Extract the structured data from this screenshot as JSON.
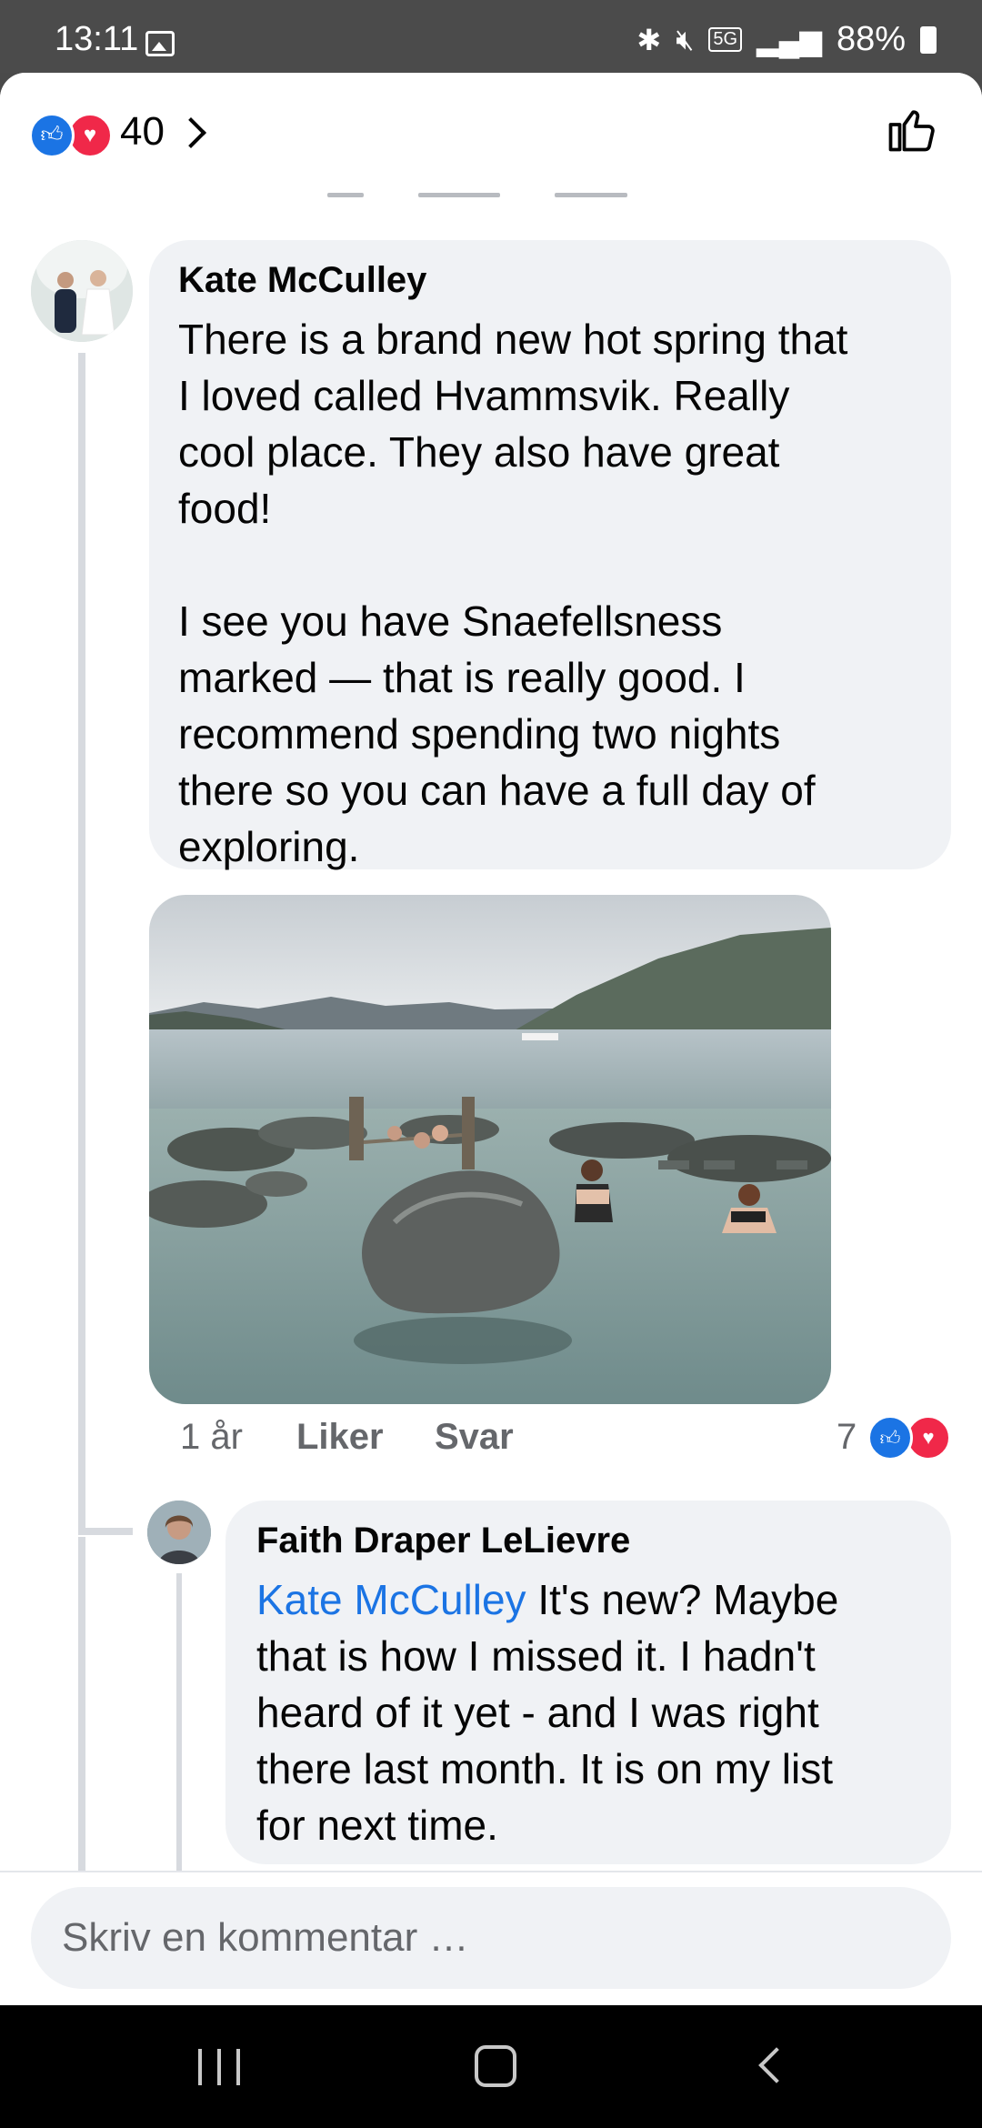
{
  "status_bar": {
    "time": "13:11",
    "network": "5G",
    "battery": "88%",
    "icons": [
      "gallery-icon",
      "bluetooth-icon",
      "mute-icon",
      "5g-icon",
      "signal-icon",
      "battery-icon"
    ]
  },
  "post_reactions": {
    "count": "40",
    "icons": [
      "like-icon",
      "love-icon"
    ],
    "colors": {
      "like": "#1b74e4",
      "love": "#f02849"
    }
  },
  "comments": [
    {
      "author": "Kate McCulley",
      "text": "There is a brand new hot spring that\nI loved called Hvammsvik. Really\ncool place. They also have great\nfood!\n\nI see you have Snaefellsness\nmarked — that is really good. I\nrecommend spending two nights\nthere so you can have a full day of\nexploring.",
      "time": "1 år",
      "like_label": "Liker",
      "reply_label": "Svar",
      "reaction_count": "7"
    },
    {
      "author": "Faith Draper LeLievre",
      "mention": "Kate McCulley",
      "text": " It's new? Maybe\nthat is how I missed it. I hadn't\nheard of it yet - and I was right\nthere last month. It is on my list\nfor next time."
    }
  ],
  "composer": {
    "placeholder": "Skriv en kommentar …"
  },
  "nav": {
    "icons": [
      "recent-apps-icon",
      "home-icon",
      "back-icon"
    ]
  }
}
